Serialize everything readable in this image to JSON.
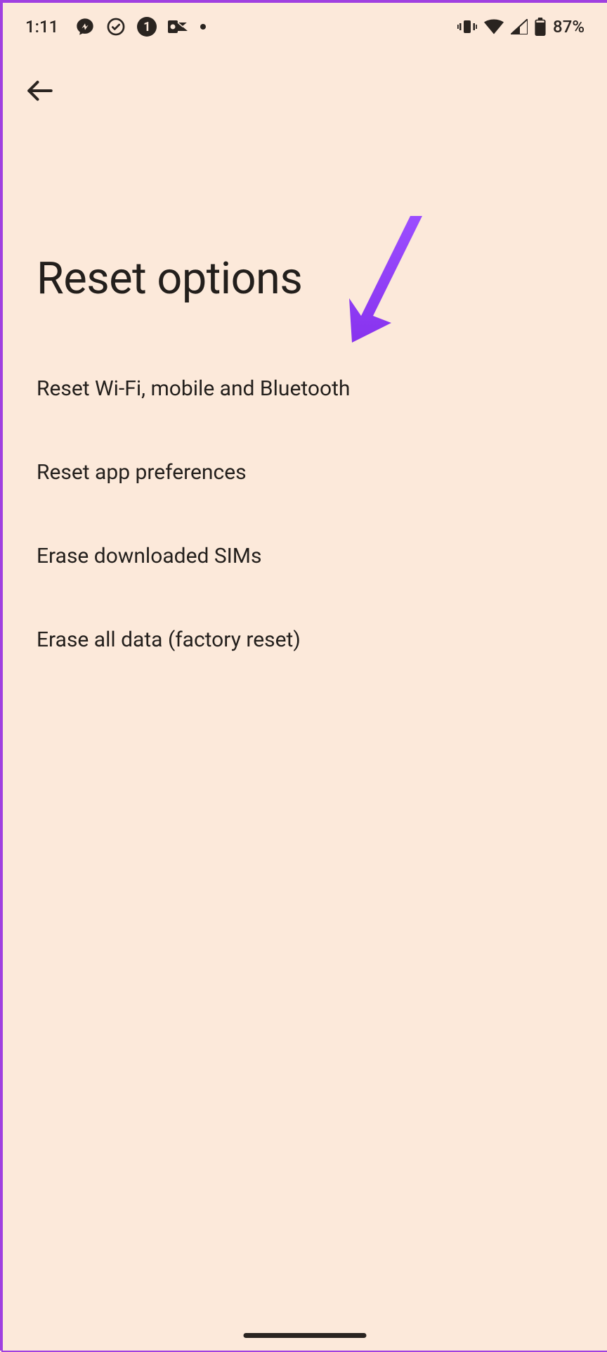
{
  "status_bar": {
    "time": "1:11",
    "badge_count": "1",
    "battery_percent": "87%"
  },
  "header": {
    "title": "Reset options"
  },
  "options": [
    {
      "label": "Reset Wi-Fi, mobile and Bluetooth"
    },
    {
      "label": "Reset app preferences"
    },
    {
      "label": "Erase downloaded SIMs"
    },
    {
      "label": "Erase all data (factory reset)"
    }
  ]
}
